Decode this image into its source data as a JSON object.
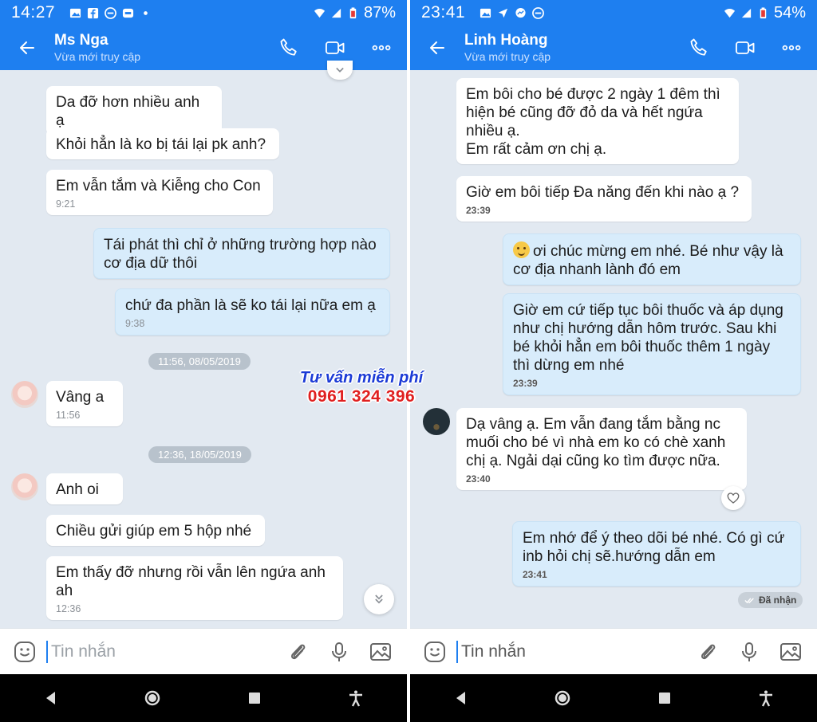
{
  "left": {
    "status": {
      "time": "14:27",
      "battery": "87%"
    },
    "header": {
      "name": "Ms Nga",
      "subtitle": "Vừa mới truy cập"
    },
    "messages": [
      {
        "text": "Da đỡ hơn nhiều anh ạ",
        "time": ""
      },
      {
        "text": "Khỏi hẳn là ko bị tái lại pk anh?",
        "time": ""
      },
      {
        "text": "Em vẫn tắm và Kiễng cho Con",
        "time": "9:21"
      },
      {
        "text": "Tái phát thì chỉ ở những trường hợp nào\ncơ địa dữ thôi",
        "time": ""
      },
      {
        "text": "chứ đa phần là sẽ ko tái lại nữa em ạ",
        "time": "9:38"
      },
      {
        "text": "Vâng a",
        "time": "11:56"
      },
      {
        "text": "Anh oi",
        "time": ""
      },
      {
        "text": "Chiều gửi giúp em 5 hộp nhé",
        "time": ""
      },
      {
        "text": "Em thấy đỡ nhưng rồi vẫn lên ngứa anh\nah",
        "time": "12:36"
      }
    ],
    "dates": [
      "11:56, 08/05/2019",
      "12:36, 18/05/2019"
    ],
    "composer_placeholder": "Tin nhắn"
  },
  "right": {
    "status": {
      "time": "23:41",
      "battery": "54%"
    },
    "header": {
      "name": "Linh Hoàng",
      "subtitle": "Vừa mới truy cập"
    },
    "messages": [
      {
        "text": "Em bôi cho bé được 2 ngày 1 đêm thì\nhiện bé cũng đỡ đỏ da và hết ngứa\nnhiều ạ.\nEm rất cảm ơn chị ạ.",
        "time": ""
      },
      {
        "text": "Giờ em bôi tiếp Đa năng đến khi nào ạ ?",
        "time": "23:39"
      },
      {
        "text": "ơi chúc mừng em nhé. Bé như vậy là\ncơ địa nhanh lành đó em",
        "time": ""
      },
      {
        "text": "Giờ em cứ tiếp tục bôi thuốc và áp dụng\nnhư chị hướng dẫn hôm trước. Sau khi\nbé khỏi hẳn em bôi thuốc thêm 1 ngày\nthì dừng em nhé",
        "time": "23:39"
      },
      {
        "text": "Dạ vâng ạ. Em vẫn đang tắm bằng nc\nmuối cho bé vì nhà em ko có chè xanh\nchị ạ. Ngải dại cũng ko tìm được nữa.",
        "time": "23:40"
      },
      {
        "text": "Em nhớ để ý theo dõi bé nhé. Có gì cứ\ninb hỏi chị sẽ.hướng dẫn em",
        "time": "23:41"
      }
    ],
    "received_label": "Đã nhận",
    "composer_placeholder": "Tin nhắn"
  },
  "promo": {
    "line1": "Tư vấn miễn phí",
    "line2": "0961 324 396"
  },
  "colors": {
    "header_blue": "#1e7ff0",
    "chat_bg": "#e2e9f1",
    "outgoing_bubble": "#d8ecfb",
    "promo_blue": "#1c3bd6",
    "promo_red": "#e02020"
  }
}
